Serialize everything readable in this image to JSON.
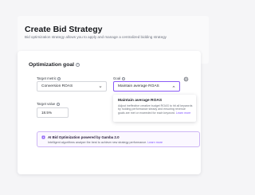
{
  "header": {
    "title": "Create Bid Strategy",
    "subtitle": "Bid optimization strategy allows you to apply and manage a centralized bidding strategy"
  },
  "optimization": {
    "section_title": "Optimization goal",
    "target_metric": {
      "label": "Target metric",
      "value": "Conversion ROAS"
    },
    "goal": {
      "label": "Goal",
      "value": "Maintain average ROAS"
    },
    "target_value": {
      "label": "Target value",
      "value": "18.5%"
    },
    "dropdown_option": {
      "title": "Maintain average ROAS",
      "description": "Adjust ineffective creative budget ROAS to hit all keywords by holding performance steady and ensuring revenue goals are met or exceeded for each keyword.",
      "learn_more": "Learn more"
    }
  },
  "ai_banner": {
    "title": "AI Bid Optimization powered by Gamba 2.0",
    "text": "Intelligent algorithms analyze the best to achieve new strategy performance.",
    "learn_more": "Learn more"
  },
  "colors": {
    "accent": "#7c4dff",
    "banner_border": "#cdb5f5",
    "banner_bg": "#fbf8ff"
  }
}
